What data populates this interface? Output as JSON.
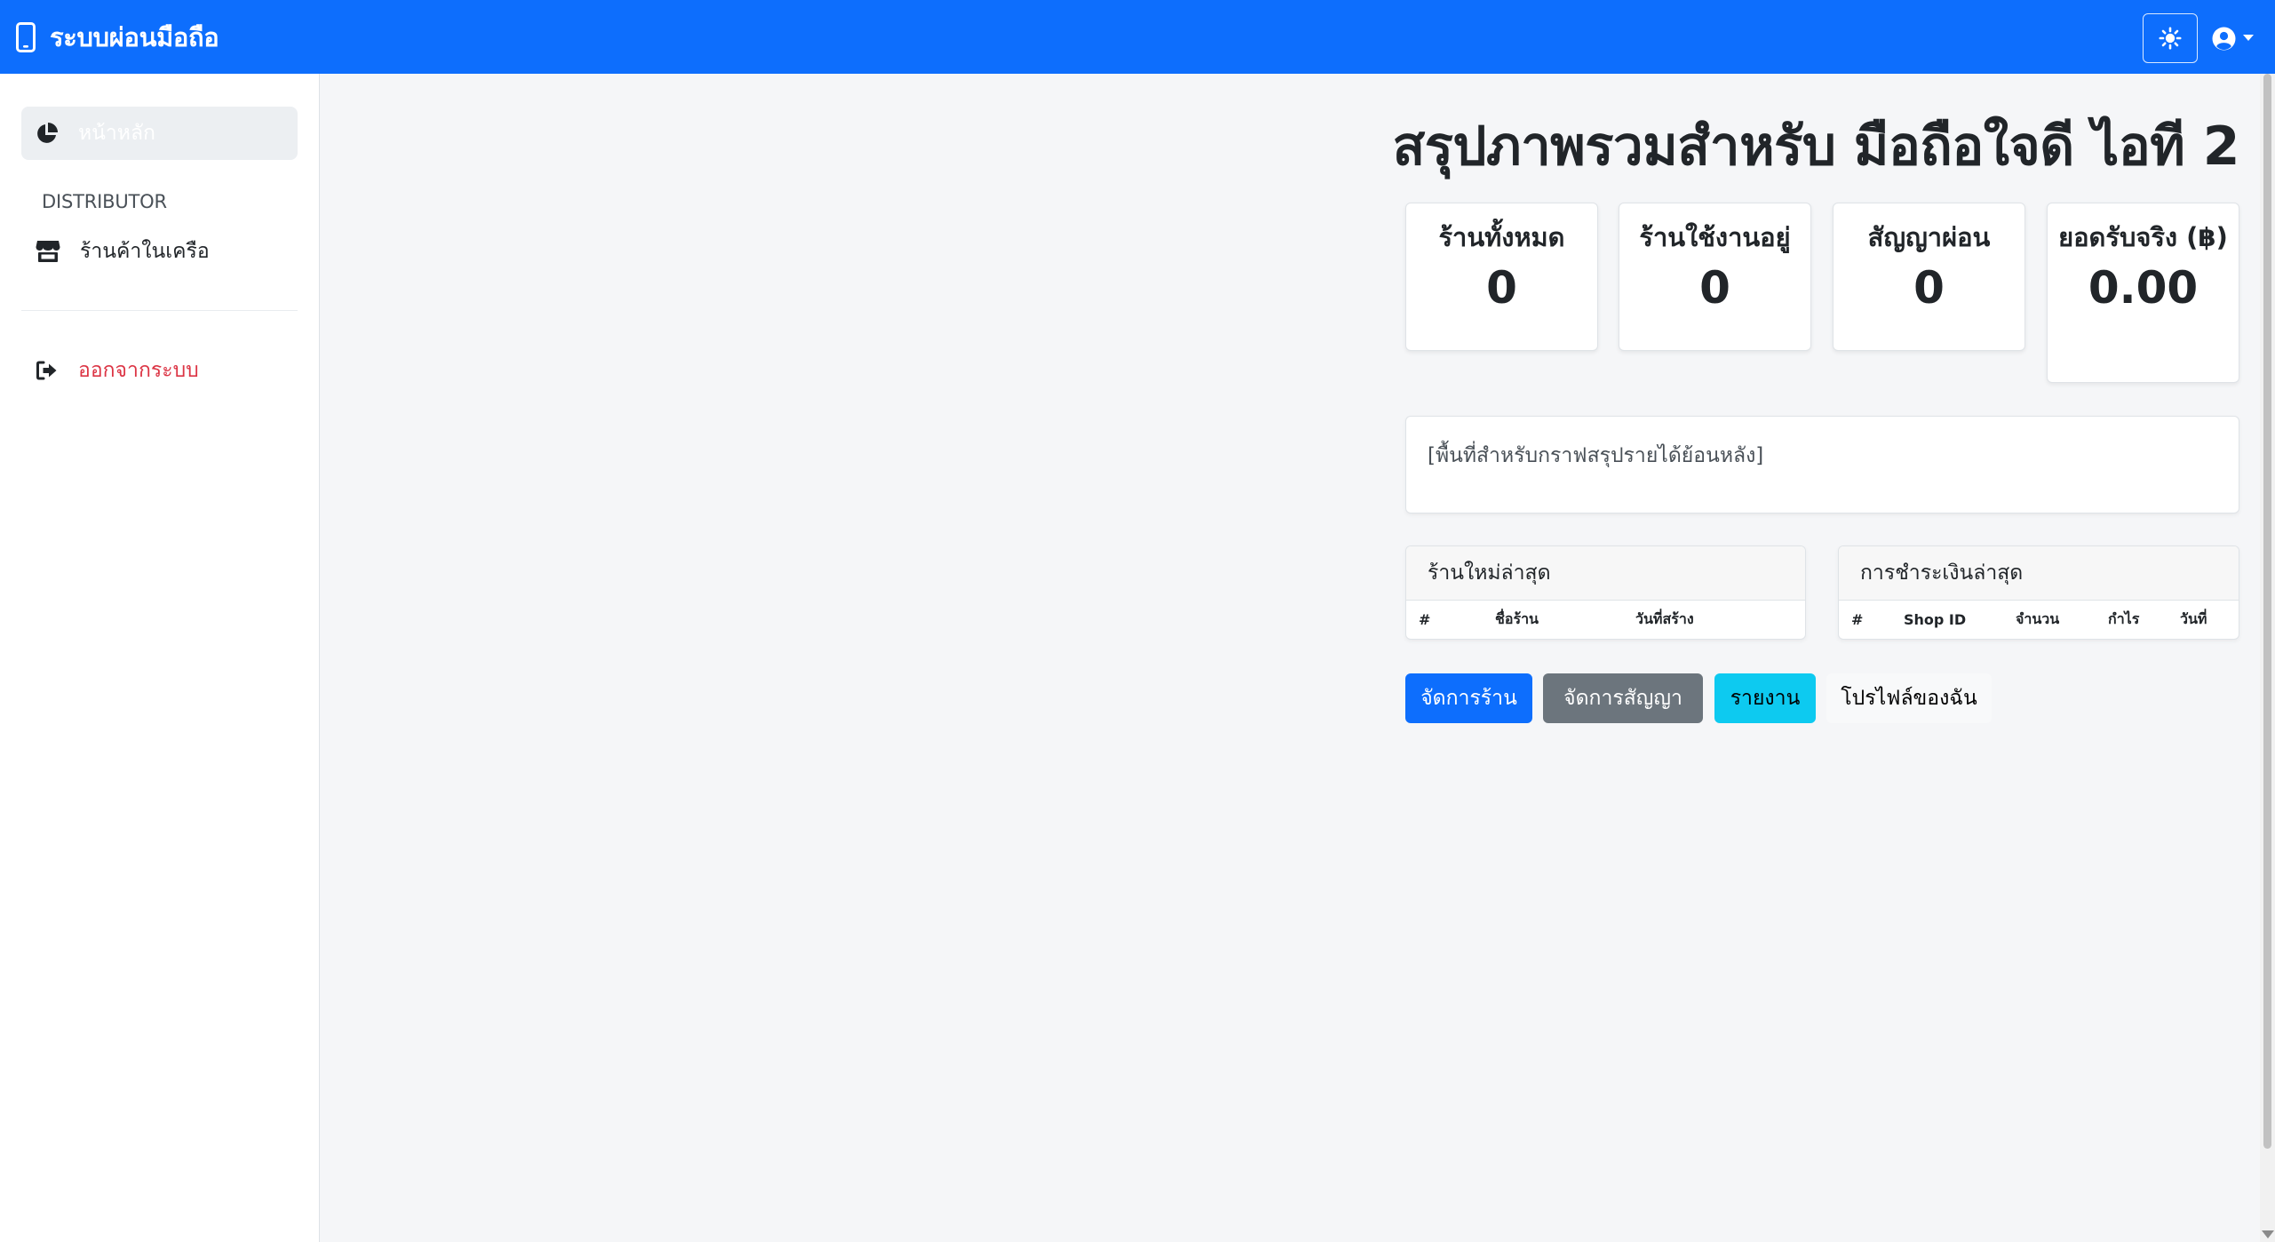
{
  "navbar": {
    "brand": "ระบบผ่อนมือถือ",
    "brand_icon": "mobile-phone-icon",
    "theme_icon": "sun-icon",
    "user_icon": "user-circle-icon"
  },
  "sidebar": {
    "items": [
      {
        "label": "หน้าหลัก",
        "icon": "chart-pie-icon",
        "active": true
      },
      {
        "label": "ร้านค้าในเครือ",
        "icon": "store-icon",
        "active": false
      }
    ],
    "section_heading": "DISTRIBUTOR",
    "logout": {
      "label": "ออกจากระบบ",
      "icon": "sign-out-icon"
    }
  },
  "main": {
    "title": "สรุปภาพรวมสำหรับ มือถือใจดี ไอที 2",
    "stats": [
      {
        "label": "ร้านทั้งหมด",
        "value": "0"
      },
      {
        "label": "ร้านใช้งานอยู่",
        "value": "0"
      },
      {
        "label": "สัญญาผ่อน",
        "value": "0"
      },
      {
        "label": "ยอดรับจริง (฿)",
        "value": "0.00"
      }
    ],
    "chart_placeholder": "[พื้นที่สำหรับกราฟสรุปรายได้ย้อนหลัง]",
    "recent_shops": {
      "title": "ร้านใหม่ล่าสุด",
      "columns": [
        "#",
        "ชื่อร้าน",
        "วันที่สร้าง"
      ]
    },
    "recent_payments": {
      "title": "การชำระเงินล่าสุด",
      "columns": [
        "#",
        "Shop ID",
        "จำนวน",
        "กำไร",
        "วันที่"
      ]
    },
    "buttons": {
      "manage_shops": "จัดการร้าน",
      "manage_contracts": "จัดการสัญญา",
      "reports": "รายงาน",
      "my_profile": "โปรไฟล์ของฉัน"
    }
  },
  "colors": {
    "primary": "#0d6efd",
    "secondary": "#6c757d",
    "info": "#0dcaf0",
    "danger": "#dc3545",
    "background": "#f5f6f8"
  }
}
